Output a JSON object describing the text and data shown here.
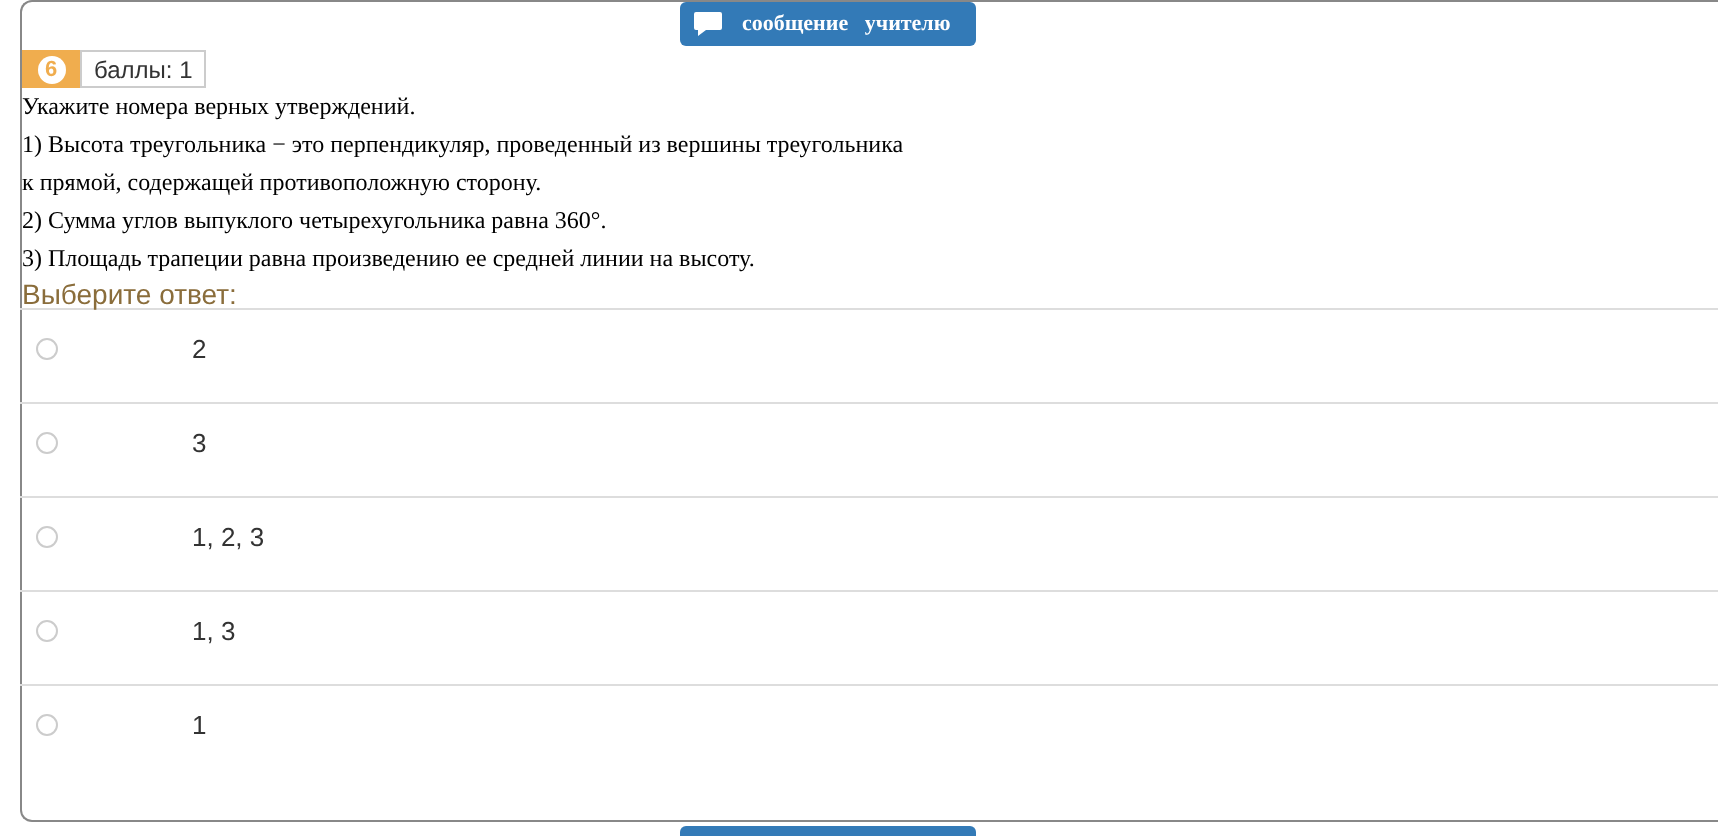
{
  "message_button": {
    "label": "сообщение   учителю"
  },
  "question": {
    "number": "6",
    "points": "баллы: 1",
    "lines": [
      "Укажите номера верных утверждений.",
      "1) Высота треугольника − это перпендикуляр, проведенный из вершины треугольника",
      "к прямой, содержащей противоположную сторону.",
      "2) Сумма углов выпуклого четырехугольника равна 360°.",
      "3) Площадь трапеции равна произведению ее средней линии на высоту."
    ],
    "prompt": "Выберите ответ:",
    "options": [
      {
        "label": "2",
        "selected": false
      },
      {
        "label": "3",
        "selected": false
      },
      {
        "label": "1, 2, 3",
        "selected": false
      },
      {
        "label": "1, 3",
        "selected": false
      },
      {
        "label": "1",
        "selected": false
      }
    ]
  }
}
